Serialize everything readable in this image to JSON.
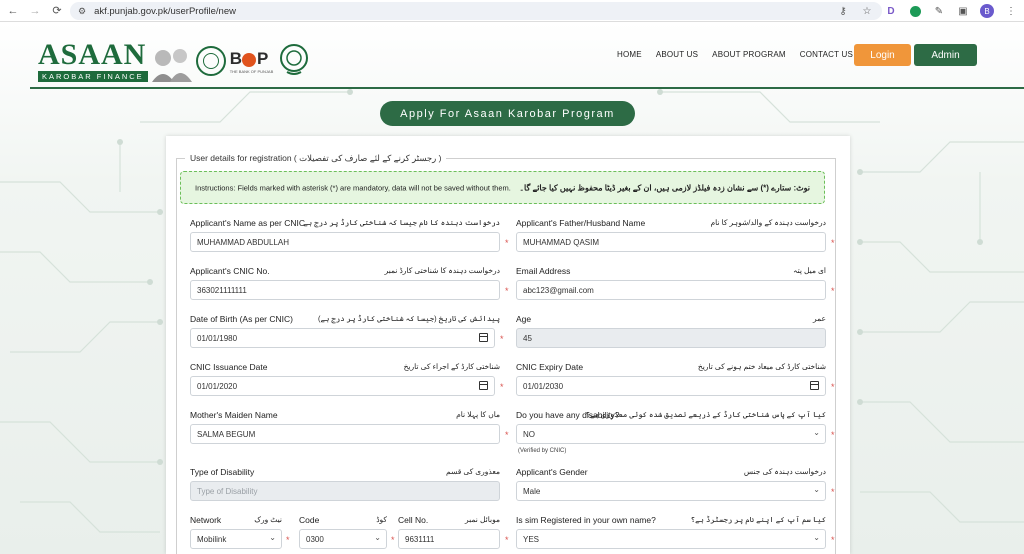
{
  "browser": {
    "url": "akf.punjab.gov.pk/userProfile/new",
    "avatar_letter": "B",
    "ext_letter": "D"
  },
  "header": {
    "logo_main": "ASAAN",
    "logo_sub": "KAROBAR FINANCE",
    "bop_text": "BOP",
    "bop_sub": "THE BANK OF PUNJAB",
    "nav": [
      "HOME",
      "ABOUT US",
      "ABOUT PROGRAM",
      "CONTACT US"
    ],
    "login_label": "Login",
    "admin_label": "Admin"
  },
  "apply_title": "Apply For Asaan Karobar Program",
  "form": {
    "legend": "User details for registration ( رجسٹر کرنے کے لئے صارف کی تفصیلات )",
    "instructions_en": "Instructions: Fields marked with asterisk (*) are mandatory, data will not be saved without them.",
    "instructions_ur": "نوٹ: ستارے (*) سے نشان زدہ فیلڈز لازمی ہیں، ان کے بغیر ڈیٹا محفوظ نہیں کیا جائے گا۔",
    "fields": {
      "name": {
        "label": "Applicant's Name as per CNIC",
        "urdu": "درخواست دہندہ کا نام جیسا کہ شناختی کارڈ پر درج ہے",
        "value": "MUHAMMAD ABDULLAH"
      },
      "father": {
        "label": "Applicant's Father/Husband Name",
        "urdu": "درخواست دہندہ کے والد/شوہر کا نام",
        "value": "MUHAMMAD QASIM"
      },
      "cnic": {
        "label": "Applicant's CNIC No.",
        "urdu": "درخواست دہندہ کا شناختی کارڈ نمبر",
        "value": "363021111111"
      },
      "email": {
        "label": "Email Address",
        "urdu": "ای میل پتہ",
        "value": "abc123@gmail.com"
      },
      "dob": {
        "label": "Date of Birth (As per CNIC)",
        "urdu": "پیدائش کی تاریخ (جیسا کہ شناختی کارڈ پر درج ہے)",
        "value": "01/01/1980"
      },
      "age": {
        "label": "Age",
        "urdu": "عمر",
        "value": "45"
      },
      "issue": {
        "label": "CNIC Issuance Date",
        "urdu": "شناختی کارڈ کے اجراء کی تاریخ",
        "value": "01/01/2020"
      },
      "expiry": {
        "label": "CNIC Expiry Date",
        "urdu": "شناختی کارڈ کی میعاد ختم ہونے کی تاریخ",
        "value": "01/01/2030"
      },
      "mother": {
        "label": "Mother's Maiden Name",
        "urdu": "ماں کا پہلا نام",
        "value": "SALMA BEGUM"
      },
      "disability": {
        "label": "Do you have any disability?",
        "urdu": "کیا آپ کے پاس شناختی کارڈ کے ذریعے تصدیق شدہ کوئی معذوری ہے؟",
        "value": "NO",
        "hint": "(Verified by CNIC)"
      },
      "disability_type": {
        "label": "Type of Disability",
        "urdu": "معذوری کی قسم",
        "placeholder": "Type of Disability"
      },
      "gender": {
        "label": "Applicant's Gender",
        "urdu": "درخواست دہندہ کی جنس",
        "value": "Male"
      },
      "network": {
        "label": "Network",
        "urdu": "نیٹ ورک",
        "value": "Mobilink"
      },
      "code": {
        "label": "Code",
        "urdu": "کوڈ",
        "value": "0300"
      },
      "cell": {
        "label": "Cell No.",
        "urdu": "موبائل نمبر",
        "value": "9631111"
      },
      "sim": {
        "label": "Is sim Registered in your own name?",
        "urdu": "کیا سم آپ کے اپنے نام پر رجسٹرڈ ہے؟",
        "value": "YES"
      }
    }
  }
}
